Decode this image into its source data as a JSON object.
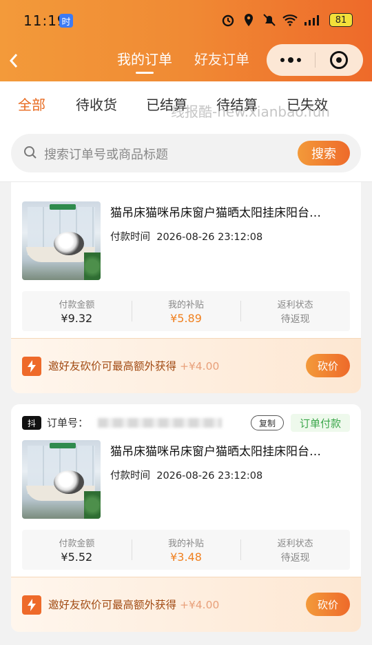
{
  "status_bar": {
    "time": "11:19",
    "badge": "时",
    "battery": "81"
  },
  "header": {
    "tabs": [
      {
        "label": "我的订单",
        "active": true
      },
      {
        "label": "好友订单",
        "active": false
      }
    ]
  },
  "filters": [
    "全部",
    "待收货",
    "已结算",
    "待结算",
    "已失效"
  ],
  "watermark": "线报酷-new.xianbao.fun",
  "search": {
    "placeholder": "搜索订单号或商品标题",
    "button": "搜索"
  },
  "orders": [
    {
      "title": "猫吊床猫咪吊床窗户猫晒太阳挂床阳台…",
      "pay_time_label": "付款时间",
      "pay_time": "2026-08-26 23:12:08",
      "stats": [
        {
          "label": "付款金额",
          "value": "¥9.32"
        },
        {
          "label": "我的补贴",
          "value": "¥5.89"
        },
        {
          "label": "返利状态",
          "value": "待返现"
        }
      ],
      "promo": {
        "text": "邀好友砍价可最高额外获得",
        "amount": "+¥4.00",
        "button": "砍价"
      }
    },
    {
      "shop_tag": "抖",
      "order_no_label": "订单号：",
      "copy": "复制",
      "status": "订单付款",
      "title": "猫吊床猫咪吊床窗户猫晒太阳挂床阳台…",
      "pay_time_label": "付款时间",
      "pay_time": "2026-08-26 23:12:08",
      "stats": [
        {
          "label": "付款金额",
          "value": "¥5.52"
        },
        {
          "label": "我的补贴",
          "value": "¥3.48"
        },
        {
          "label": "返利状态",
          "value": "待返现"
        }
      ],
      "promo": {
        "text": "邀好友砍价可最高额外获得",
        "amount": "+¥4.00",
        "button": "砍价"
      }
    }
  ],
  "colors": {
    "accent": "#ee6a2a",
    "accent_light": "#f39a3a",
    "status_green": "#3aa64a"
  }
}
